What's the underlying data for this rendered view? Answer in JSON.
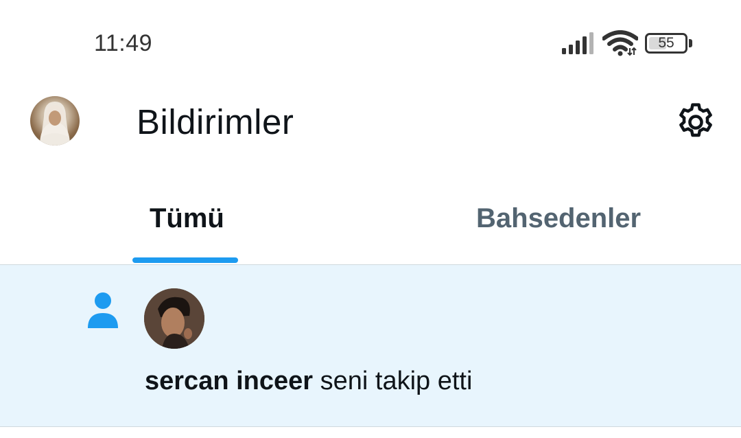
{
  "status_bar": {
    "time": "11:49",
    "battery": "55",
    "battery_level": 0.55,
    "icons": [
      "signal-icon",
      "wifi-icon",
      "battery-icon"
    ]
  },
  "header": {
    "title": "Bildirimler",
    "avatar": "profile-avatar",
    "settings_icon": "gear-icon"
  },
  "tabs": [
    {
      "label": "Tümü",
      "active": true
    },
    {
      "label": "Bahsedenler",
      "active": false
    }
  ],
  "notifications": [
    {
      "icon": "person-icon",
      "avatar": "user-avatar",
      "user": "sercan inceer",
      "action": " seni takip etti"
    }
  ],
  "colors": {
    "accent": "#1d9bf0",
    "highlight_bg": "#e8f5fd",
    "text_primary": "#0f1419",
    "text_secondary": "#536471",
    "divider": "#cfd9de"
  }
}
